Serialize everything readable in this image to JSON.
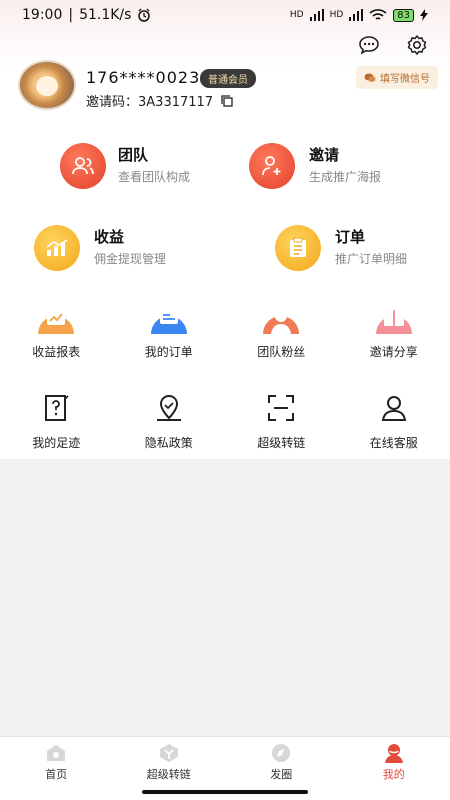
{
  "status": {
    "time": "19:00",
    "speed": "51.1K/s",
    "network_labels": [
      "HD",
      "HD"
    ],
    "battery": "83"
  },
  "profile": {
    "phone": "176****0023",
    "member_level": "普通会员",
    "invite_label": "邀请码：",
    "invite_code": "3A3317117",
    "wechat_button": "填写微信号"
  },
  "main_cards": [
    {
      "title": "团队",
      "subtitle": "查看团队构成",
      "icon": "team-icon",
      "color": "#f0543a"
    },
    {
      "title": "邀请",
      "subtitle": "生成推广海报",
      "icon": "invite-icon",
      "color": "#f0543a"
    },
    {
      "title": "收益",
      "subtitle": "佣金提现管理",
      "icon": "earnings-icon",
      "color": "#f6b223"
    },
    {
      "title": "订单",
      "subtitle": "推广订单明细",
      "icon": "order-icon",
      "color": "#f6b223"
    }
  ],
  "grid_row_1": [
    {
      "label": "收益报表",
      "icon": "report-icon",
      "color": "#f6a24a"
    },
    {
      "label": "我的订单",
      "icon": "my-order-icon",
      "color": "#3b86f0"
    },
    {
      "label": "团队粉丝",
      "icon": "fans-icon",
      "color": "#f07a54"
    },
    {
      "label": "邀请分享",
      "icon": "gift-icon",
      "color": "#f48f9a"
    }
  ],
  "grid_row_2": [
    {
      "label": "我的足迹",
      "icon": "footprint-icon"
    },
    {
      "label": "隐私政策",
      "icon": "privacy-icon"
    },
    {
      "label": "超级转链",
      "icon": "scan-icon"
    },
    {
      "label": "在线客服",
      "icon": "service-icon"
    }
  ],
  "tabs": [
    {
      "label": "首页",
      "icon": "home-icon",
      "active": false
    },
    {
      "label": "超级转链",
      "icon": "transfer-icon",
      "active": false
    },
    {
      "label": "发圈",
      "icon": "compass-icon",
      "active": false
    },
    {
      "label": "我的",
      "icon": "profile-icon",
      "active": true
    }
  ],
  "colors": {
    "accent": "#e04b3b",
    "tab_inactive": "#333333"
  }
}
